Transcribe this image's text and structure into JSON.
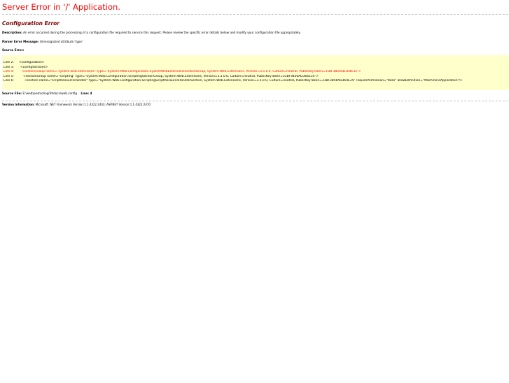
{
  "header": {
    "title": "Server Error in '/' Application."
  },
  "error": {
    "title": "Configuration Error",
    "description_label": "Description:",
    "description_text": "An error occurred during the processing of a configuration file required to service this request. Please review the specific error details below and modify your configuration file appropriately.",
    "parser_label": "Parser Error Message:",
    "parser_text": "Unrecognized attribute 'type'.",
    "source_error_label": "Source Error:"
  },
  "source_code": {
    "lines": [
      {
        "number": "Line 2:",
        "code": "<configuration>",
        "highlight": false
      },
      {
        "number": "Line 3:",
        "code": "<configSections>",
        "highlight": false
      },
      {
        "number": "Line 4:",
        "code": "<sectionGroup name=\"system.web.extensions\" type=\"System.Web.Configuration.SystemWebExtensionsSectionGroup, System.Web.Extensions, Version=3.5.0.0, Culture=neutral, PublicKeyToken=31BF3856AD364E35\">",
        "highlight": true
      },
      {
        "number": "Line 5:",
        "code": "<sectionGroup name=\"scripting\" type=\"System.Web.Configuration.ScriptingSectionGroup, System.Web.Extensions, Version=3.5.0.0, Culture=neutral, PublicKeyToken=31BF3856AD364E35\">",
        "highlight": false
      },
      {
        "number": "Line 6:",
        "code": "<section name=\"scriptResourceHandler\" type=\"System.Web.Configuration.ScriptingScriptResourceHandlerSection, System.Web.Extensions, Version=3.5.0.0, Culture=neutral, PublicKeyToken=31BF3856AD364E35\" requirePermission=\"false\" allowDefinition=\"MachineToApplication\"/>",
        "highlight": false
      }
    ]
  },
  "source_file": {
    "label": "Source File:",
    "path": "E:\\web\\postsolingi\\htdocs\\web.config",
    "line_text": "Line: 4"
  },
  "version": {
    "label": "Version Information:",
    "text": "Microsoft .NET Framework Version:1.1.4322.2443; ASP.NET Version:1.1.4322.2470"
  },
  "colors": {
    "title_red": "#ff0000",
    "section_maroon": "#800000",
    "code_background": "#ffffcc"
  }
}
